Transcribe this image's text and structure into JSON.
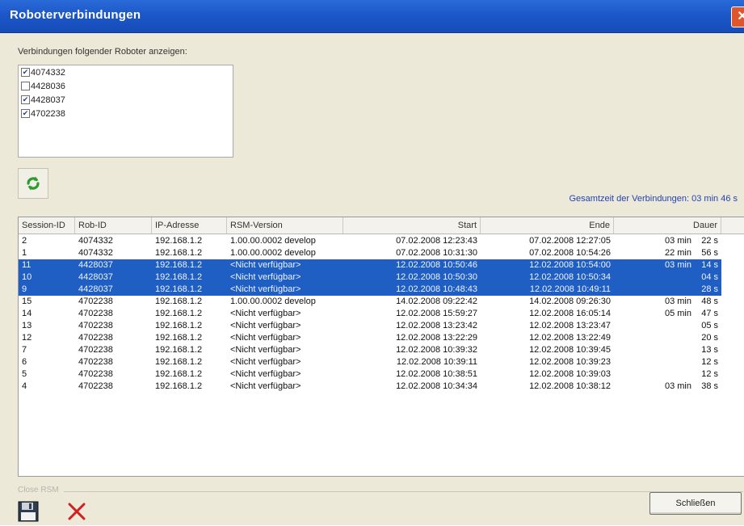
{
  "window": {
    "title": "Roboterverbindungen",
    "close_glyph": "✕"
  },
  "filter": {
    "label": "Verbindungen folgender Roboter anzeigen:",
    "robots": [
      {
        "id": "4074332",
        "checked": true
      },
      {
        "id": "4428036",
        "checked": false
      },
      {
        "id": "4428037",
        "checked": true
      },
      {
        "id": "4702238",
        "checked": true
      }
    ]
  },
  "refresh": {
    "icon": "refresh-icon",
    "color": "#2e9b2e"
  },
  "total_time": "Gesamtzeit der Verbindungen: 03 min  46 s",
  "table": {
    "columns": [
      "Session-ID",
      "Rob-ID",
      "IP-Adresse",
      "RSM-Version",
      "Start",
      "Ende",
      "Dauer"
    ],
    "rows": [
      {
        "session": "2",
        "rob": "4074332",
        "ip": "192.168.1.2",
        "rsm": "1.00.00.0002 develop",
        "start": "07.02.2008 12:23:43",
        "end": "07.02.2008 12:27:05",
        "dur_min": "03 min",
        "dur_sec": "22 s",
        "selected": false
      },
      {
        "session": "1",
        "rob": "4074332",
        "ip": "192.168.1.2",
        "rsm": "1.00.00.0002 develop",
        "start": "07.02.2008 10:31:30",
        "end": "07.02.2008 10:54:26",
        "dur_min": "22 min",
        "dur_sec": "56 s",
        "selected": false
      },
      {
        "session": "11",
        "rob": "4428037",
        "ip": "192.168.1.2",
        "rsm": "<Nicht verfügbar>",
        "start": "12.02.2008 10:50:46",
        "end": "12.02.2008 10:54:00",
        "dur_min": "03 min",
        "dur_sec": "14 s",
        "selected": true
      },
      {
        "session": "10",
        "rob": "4428037",
        "ip": "192.168.1.2",
        "rsm": "<Nicht verfügbar>",
        "start": "12.02.2008 10:50:30",
        "end": "12.02.2008 10:50:34",
        "dur_min": "",
        "dur_sec": "04 s",
        "selected": true
      },
      {
        "session": "9",
        "rob": "4428037",
        "ip": "192.168.1.2",
        "rsm": "<Nicht verfügbar>",
        "start": "12.02.2008 10:48:43",
        "end": "12.02.2008 10:49:11",
        "dur_min": "",
        "dur_sec": "28 s",
        "selected": true
      },
      {
        "session": "15",
        "rob": "4702238",
        "ip": "192.168.1.2",
        "rsm": "1.00.00.0002 develop",
        "start": "14.02.2008 09:22:42",
        "end": "14.02.2008 09:26:30",
        "dur_min": "03 min",
        "dur_sec": "48 s",
        "selected": false
      },
      {
        "session": "14",
        "rob": "4702238",
        "ip": "192.168.1.2",
        "rsm": "<Nicht verfügbar>",
        "start": "12.02.2008 15:59:27",
        "end": "12.02.2008 16:05:14",
        "dur_min": "05 min",
        "dur_sec": "47 s",
        "selected": false
      },
      {
        "session": "13",
        "rob": "4702238",
        "ip": "192.168.1.2",
        "rsm": "<Nicht verfügbar>",
        "start": "12.02.2008 13:23:42",
        "end": "12.02.2008 13:23:47",
        "dur_min": "",
        "dur_sec": "05 s",
        "selected": false
      },
      {
        "session": "12",
        "rob": "4702238",
        "ip": "192.168.1.2",
        "rsm": "<Nicht verfügbar>",
        "start": "12.02.2008 13:22:29",
        "end": "12.02.2008 13:22:49",
        "dur_min": "",
        "dur_sec": "20 s",
        "selected": false
      },
      {
        "session": "7",
        "rob": "4702238",
        "ip": "192.168.1.2",
        "rsm": "<Nicht verfügbar>",
        "start": "12.02.2008 10:39:32",
        "end": "12.02.2008 10:39:45",
        "dur_min": "",
        "dur_sec": "13 s",
        "selected": false
      },
      {
        "session": "6",
        "rob": "4702238",
        "ip": "192.168.1.2",
        "rsm": "<Nicht verfügbar>",
        "start": "12.02.2008 10:39:11",
        "end": "12.02.2008 10:39:23",
        "dur_min": "",
        "dur_sec": "12 s",
        "selected": false
      },
      {
        "session": "5",
        "rob": "4702238",
        "ip": "192.168.1.2",
        "rsm": "<Nicht verfügbar>",
        "start": "12.02.2008 10:38:51",
        "end": "12.02.2008 10:39:03",
        "dur_min": "",
        "dur_sec": "12 s",
        "selected": false
      },
      {
        "session": "4",
        "rob": "4702238",
        "ip": "192.168.1.2",
        "rsm": "<Nicht verfügbar>",
        "start": "12.02.2008 10:34:34",
        "end": "12.02.2008 10:38:12",
        "dur_min": "03 min",
        "dur_sec": "38 s",
        "selected": false
      }
    ]
  },
  "group_label": "Close RSM",
  "buttons": {
    "save_icon": "floppy-disk-icon",
    "delete_icon": "red-x-icon",
    "close_label": "Schließen"
  },
  "colors": {
    "title_bar": "#1c57c9",
    "selection": "#1f5fc4",
    "link_blue": "#2443b5",
    "delete_red": "#d21f1f"
  }
}
